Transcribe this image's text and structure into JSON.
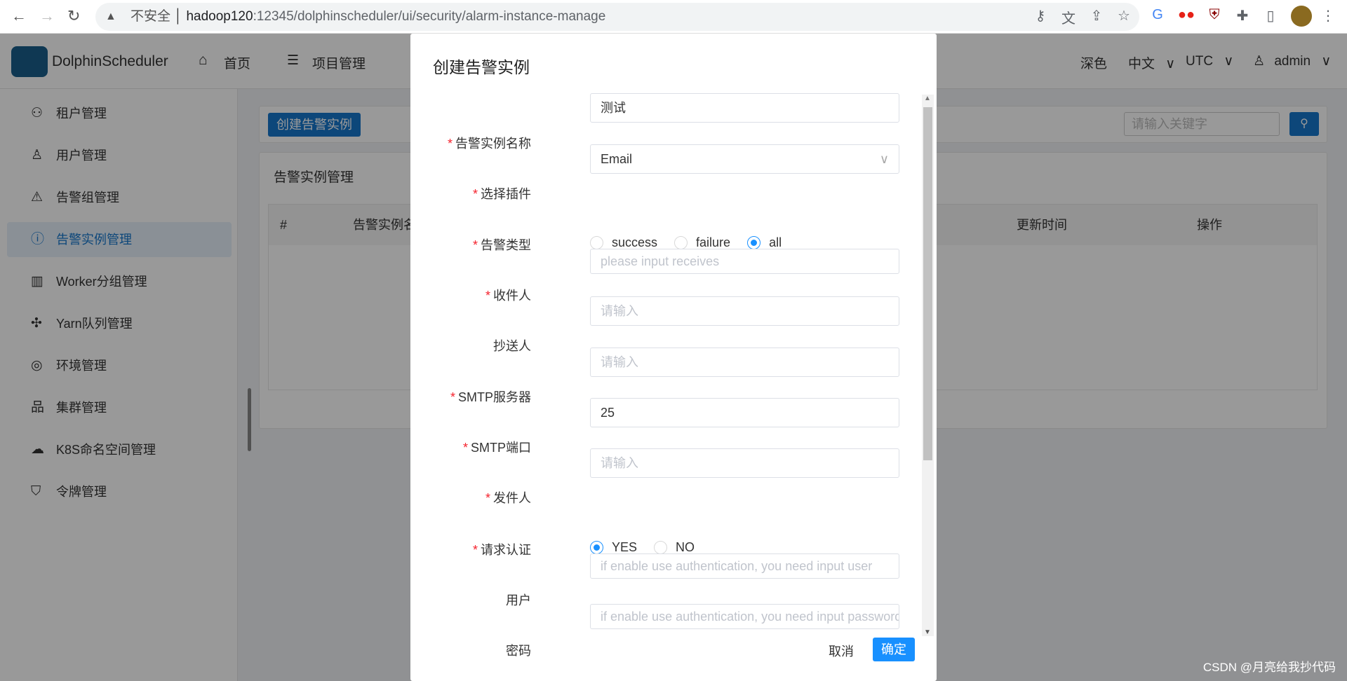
{
  "browser": {
    "security": "不安全",
    "host": "hadoop120",
    "url_rest": ":12345/dolphinscheduler/ui/security/alarm-instance-manage"
  },
  "header": {
    "logo": "DolphinScheduler",
    "nav": [
      "首页",
      "项目管理"
    ],
    "theme": "深色",
    "lang": "中文",
    "tz": "UTC",
    "user": "admin"
  },
  "sidebar": {
    "items": [
      {
        "label": "租户管理",
        "icon": "tenant-icon"
      },
      {
        "label": "用户管理",
        "icon": "user-icon"
      },
      {
        "label": "告警组管理",
        "icon": "warning-icon"
      },
      {
        "label": "告警实例管理",
        "icon": "info-icon",
        "active": true
      },
      {
        "label": "Worker分组管理",
        "icon": "worker-icon"
      },
      {
        "label": "Yarn队列管理",
        "icon": "slack-icon"
      },
      {
        "label": "环境管理",
        "icon": "location-icon"
      },
      {
        "label": "集群管理",
        "icon": "cluster-icon"
      },
      {
        "label": "K8S命名空间管理",
        "icon": "cloud-icon"
      },
      {
        "label": "令牌管理",
        "icon": "shield-icon"
      }
    ]
  },
  "page": {
    "create_button": "创建告警实例",
    "search_placeholder": "请输入关键字",
    "table_title": "告警实例管理",
    "columns": [
      "#",
      "告警实例名",
      "更新时间",
      "操作"
    ]
  },
  "modal": {
    "title": "创建告警实例",
    "cancel": "取消",
    "ok": "确定",
    "fields": {
      "name": {
        "label": "告警实例名称",
        "value": "测试"
      },
      "plugin": {
        "label": "选择插件",
        "value": "Email"
      },
      "type": {
        "label": "告警类型",
        "options": [
          "success",
          "failure",
          "all"
        ],
        "selected": "all"
      },
      "receivers": {
        "label": "收件人",
        "placeholder": "please input receives"
      },
      "cc": {
        "label": "抄送人",
        "placeholder": "请输入"
      },
      "smtp_host": {
        "label": "SMTP服务器",
        "placeholder": "请输入"
      },
      "smtp_port": {
        "label": "SMTP端口",
        "value": "25"
      },
      "sender": {
        "label": "发件人",
        "placeholder": "请输入"
      },
      "auth": {
        "label": "请求认证",
        "options": [
          "YES",
          "NO"
        ],
        "selected": "YES"
      },
      "user": {
        "label": "用户",
        "placeholder": "if enable use authentication, you need input user"
      },
      "password": {
        "label": "密码",
        "placeholder": "if enable use authentication, you need input password"
      }
    }
  },
  "watermark": "CSDN @月亮给我抄代码",
  "colors": {
    "primary": "#1890ff",
    "required": "#f5222d"
  }
}
